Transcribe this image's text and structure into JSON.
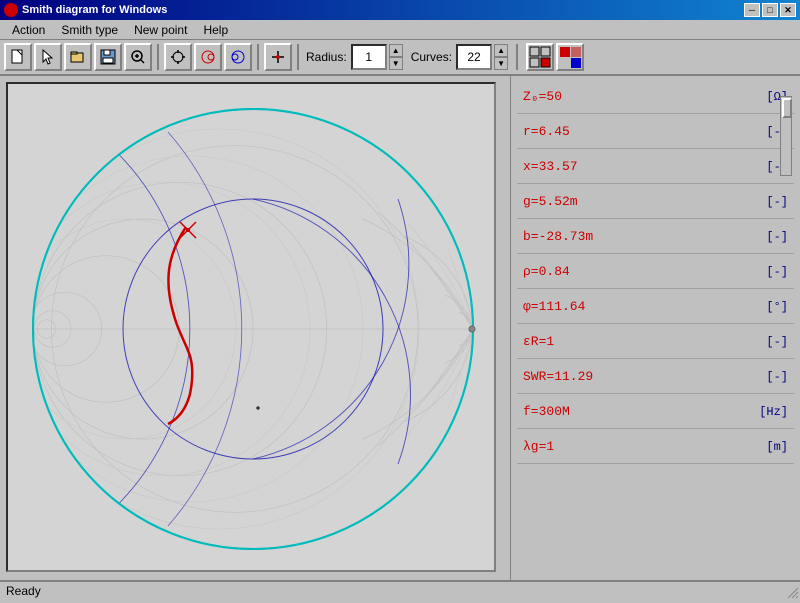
{
  "titleBar": {
    "title": "Smith diagram for Windows",
    "minBtn": "─",
    "maxBtn": "□",
    "closeBtn": "✕"
  },
  "menu": {
    "items": [
      "Action",
      "Smith type",
      "New point",
      "Help"
    ]
  },
  "toolbar": {
    "radiusLabel": "Radius:",
    "radiusValue": "1",
    "curvesLabel": "Curves:",
    "curvesValue": "22"
  },
  "infoPanel": {
    "rows": [
      {
        "label": "Z₀=50",
        "value": "Z₀=50",
        "unit": "[Ω]"
      },
      {
        "label": "r=6.45",
        "value": "r=6.45",
        "unit": "[-]"
      },
      {
        "label": "x=33.57",
        "value": "x=33.57",
        "unit": "[-]"
      },
      {
        "label": "g=5.52m",
        "value": "g=5.52m",
        "unit": "[-]"
      },
      {
        "label": "b=-28.73m",
        "value": "b=-28.73m",
        "unit": "[-]"
      },
      {
        "label": "ρ=0.84",
        "value": "ρ=0.84",
        "unit": "[-]"
      },
      {
        "label": "φ=111.64",
        "value": "φ=111.64",
        "unit": "[°]"
      },
      {
        "label": "εR=1",
        "value": "εR=1",
        "unit": "[-]"
      },
      {
        "label": "SWR=11.29",
        "value": "SWR=11.29",
        "unit": "[-]"
      },
      {
        "label": "f=300M",
        "value": "f=300M",
        "unit": "[Hz]"
      },
      {
        "label": "λg=1",
        "value": "λg=1",
        "unit": "[m]"
      }
    ]
  },
  "statusBar": {
    "text": "Ready"
  }
}
